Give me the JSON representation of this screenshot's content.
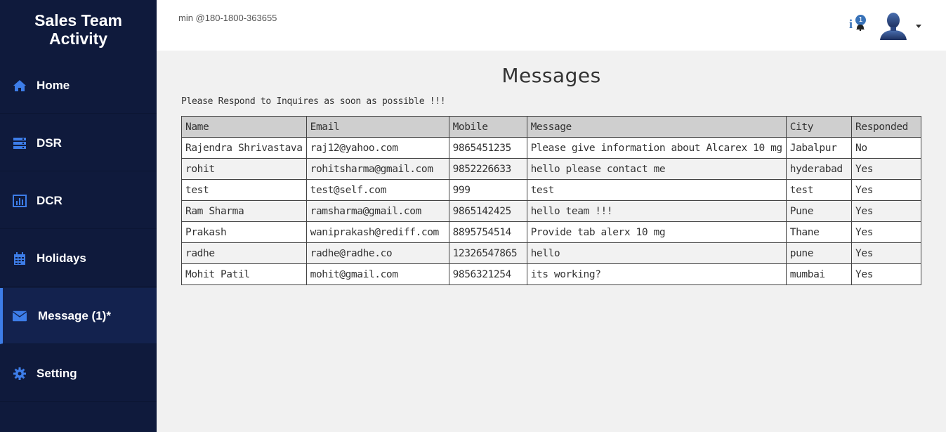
{
  "brand": {
    "line1": "Sales Team",
    "line2": "Activity"
  },
  "sidebar": {
    "items": [
      {
        "label": "Home",
        "icon": "home-icon"
      },
      {
        "label": "DSR",
        "icon": "server-icon"
      },
      {
        "label": "DCR",
        "icon": "bar-chart-icon"
      },
      {
        "label": "Holidays",
        "icon": "calendar-icon"
      },
      {
        "label": "Message (1)*",
        "icon": "envelope-icon",
        "active": true
      },
      {
        "label": "Setting",
        "icon": "gear-icon"
      }
    ]
  },
  "topbar": {
    "contact": "min @180-1800-363655",
    "notification_count": "1",
    "notification_icon": "info-icon"
  },
  "main": {
    "title": "Messages",
    "subtitle": "Please Respond to Inquires as soon as possible !!!",
    "table": {
      "headers": [
        "Name",
        "Email",
        "Mobile",
        "Message",
        "City",
        "Responded"
      ],
      "rows": [
        [
          "Rajendra Shrivastava",
          "raj12@yahoo.com",
          "9865451235",
          "Please give information about Alcarex 10 mg",
          "Jabalpur",
          "No"
        ],
        [
          "rohit",
          "rohitsharma@gmail.com",
          "9852226633",
          "hello please contact me",
          "hyderabad",
          "Yes"
        ],
        [
          "test",
          "test@self.com",
          "999",
          "test",
          "test",
          "Yes"
        ],
        [
          "Ram Sharma",
          "ramsharma@gmail.com",
          "9865142425",
          "hello team !!!",
          "Pune",
          "Yes"
        ],
        [
          "Prakash",
          "waniprakash@rediff.com",
          "8895754514",
          "Provide tab alerx 10 mg",
          "Thane",
          "Yes"
        ],
        [
          "radhe",
          "radhe@radhe.co",
          "12326547865",
          "hello",
          "pune",
          "Yes"
        ],
        [
          "Mohit Patil",
          "mohit@gmail.com",
          "9856321254",
          "its working?",
          "mumbai",
          "Yes"
        ]
      ]
    }
  },
  "colors": {
    "sidebar_bg": "#0f1a3c",
    "accent": "#3d7de8",
    "content_bg": "#f1f1f1"
  }
}
